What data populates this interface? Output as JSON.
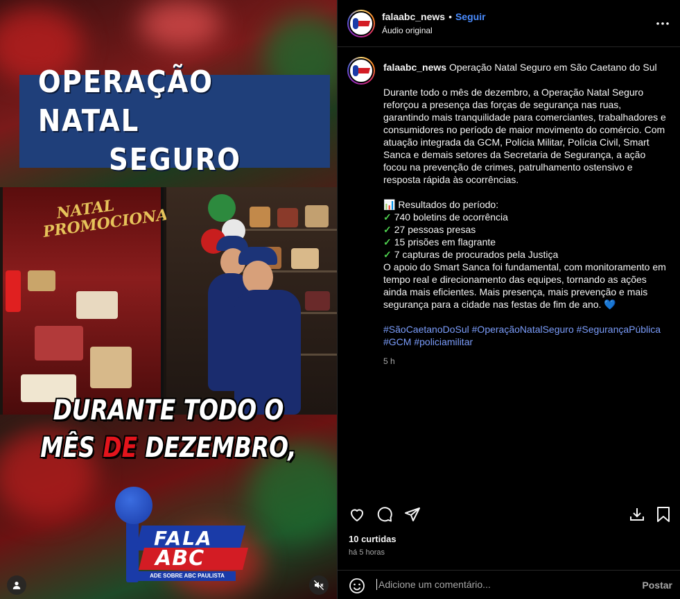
{
  "media": {
    "title_line1": "OPERAÇÃO NATAL",
    "title_line2": "SEGURO",
    "window_banner": "NATAL PROMOCIONAL",
    "caption_line1": "DURANTE TODO O",
    "caption_line2_a": "MÊS",
    "caption_line2_b": "DE",
    "caption_line2_c": "DEZEMBRO,",
    "logo_fala": "FALA",
    "logo_abc": "ABC",
    "logo_tagline": "ADE SOBRE ABC PAULISTA",
    "brand_blue": "#1a3ba8",
    "brand_red": "#d31c24"
  },
  "header": {
    "username": "falaabc_news",
    "separator": "•",
    "follow_label": "Seguir",
    "audio_label": "Áudio original"
  },
  "caption": {
    "username": "falaabc_news",
    "headline": "Operação Natal Seguro em São Caetano do Sul",
    "paragraph1": "Durante todo o mês de dezembro, a Operação Natal Seguro reforçou a presença das forças de segurança nas ruas, garantindo mais tranquilidade para comerciantes, trabalhadores e consumidores no período de maior movimento do comércio. Com atuação integrada da GCM, Polícia Militar, Polícia Civil, Smart Sanca e demais setores da Secretaria de Segurança, a ação focou na prevenção de crimes, patrulhamento ostensivo e resposta rápida às ocorrências.",
    "results_title": "📊 Resultados do período:",
    "results": [
      "740 boletins de ocorrência",
      "27 pessoas presas",
      "15 prisões em flagrante",
      "7 capturas de procurados pela Justiça"
    ],
    "check_glyph": "✓",
    "paragraph2": "O apoio do Smart Sanca foi fundamental, com monitoramento em tempo real e direcionamento das equipes, tornando as ações ainda mais eficientes. Mais presença, mais prevenção e mais segurança para a cidade nas festas de fim de ano. 💙",
    "hashtags_line1": "#SãoCaetanoDoSul #OperaçãoNatalSeguro #SegurançaPública",
    "hashtags_line2": "#GCM #policiamilitar",
    "time": "5 h"
  },
  "actions": {
    "like_icon": "heart-icon",
    "comment_icon": "comment-icon",
    "share_icon": "send-icon",
    "download_icon": "download-icon",
    "save_icon": "bookmark-icon"
  },
  "stats": {
    "likes": "10 curtidas",
    "posted": "há 5 horas"
  },
  "composer": {
    "placeholder": "Adicione um comentário...",
    "post_label": "Postar"
  }
}
